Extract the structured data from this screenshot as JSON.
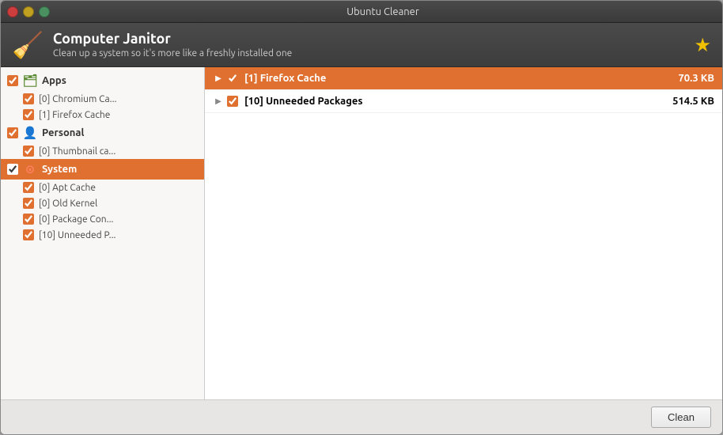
{
  "window": {
    "title": "Ubuntu Cleaner",
    "buttons": {
      "close": "close",
      "minimize": "minimize",
      "maximize": "maximize"
    }
  },
  "header": {
    "title": "Computer Janitor",
    "subtitle": "Clean up a system so it's more like a freshly installed one",
    "broom": "🧹",
    "star": "★"
  },
  "sidebar": {
    "categories": [
      {
        "id": "apps",
        "label": "Apps",
        "icon": "📁",
        "checked": true,
        "active": false,
        "items": [
          {
            "label": "[0] Chromium Ca...",
            "checked": true
          },
          {
            "label": "[1] Firefox Cache",
            "checked": true
          }
        ]
      },
      {
        "id": "personal",
        "label": "Personal",
        "icon": "👤",
        "checked": true,
        "active": false,
        "items": [
          {
            "label": "[0] Thumbnail ca...",
            "checked": true
          }
        ]
      },
      {
        "id": "system",
        "label": "System",
        "icon": "⚙",
        "checked": true,
        "active": true,
        "items": [
          {
            "label": "[0] Apt Cache",
            "checked": true
          },
          {
            "label": "[0] Old Kernel",
            "checked": true
          },
          {
            "label": "[0] Package Con...",
            "checked": true
          },
          {
            "label": "[10] Unneeded P...",
            "checked": true
          }
        ]
      }
    ]
  },
  "content": {
    "rows": [
      {
        "label": "[1] Firefox Cache",
        "size": "70.3 KB",
        "checked": true,
        "active": true,
        "expanded": true
      },
      {
        "label": "[10] Unneeded Packages",
        "size": "514.5 KB",
        "checked": true,
        "active": false,
        "expanded": false
      }
    ]
  },
  "bottom": {
    "clean_label": "Clean"
  }
}
